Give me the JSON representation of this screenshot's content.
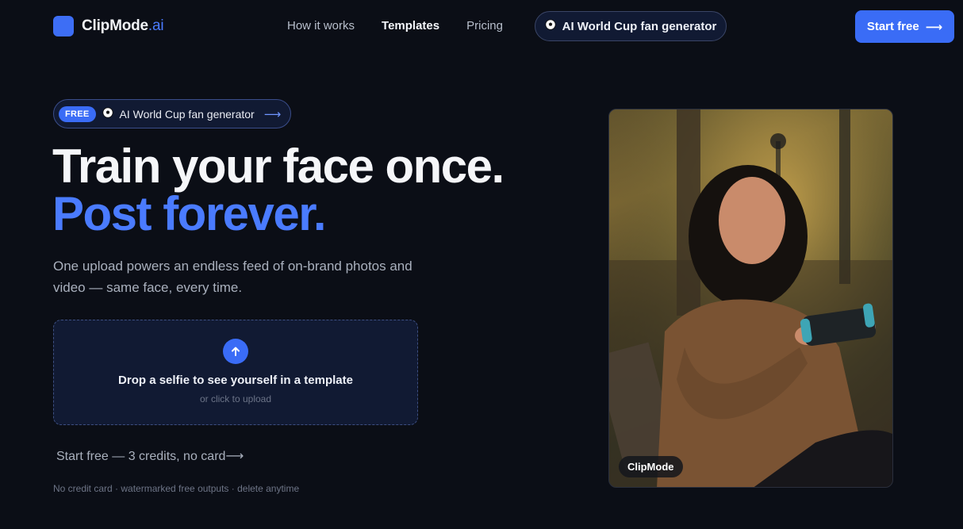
{
  "brand": {
    "name": "ClipMode",
    "tld": ".ai",
    "icon": "moon-icon"
  },
  "nav": {
    "items": [
      {
        "label": "How it works",
        "active": false
      },
      {
        "label": "Templates",
        "active": true
      },
      {
        "label": "Pricing",
        "active": false
      }
    ],
    "pill": {
      "icon": "soccer-ball-icon",
      "label": "AI World Cup fan generator"
    },
    "cta": {
      "label": "Start free",
      "arrow": "⟶"
    }
  },
  "hero": {
    "badge": {
      "tag": "FREE",
      "icon": "soccer-ball-icon",
      "label": "AI World Cup fan generator",
      "arrow": "⟶"
    },
    "headline_line1": "Train your face once.",
    "headline_line2": "Post forever.",
    "subtitle": "One upload powers an endless feed of on-brand photos and video — same face, every time.",
    "dropzone": {
      "icon": "upload-arrow-icon",
      "title": "Drop a selfie to see yourself in a template",
      "hint": "or click to upload"
    },
    "cta_text": "Start free — 3 credits, no card⟶",
    "fine_print": "No credit card · watermarked free outputs · delete anytime"
  },
  "preview": {
    "label": "ClipMode"
  },
  "colors": {
    "background": "#0b0e16",
    "accent": "#3a6cf6",
    "accent_text": "#4a7bff"
  }
}
